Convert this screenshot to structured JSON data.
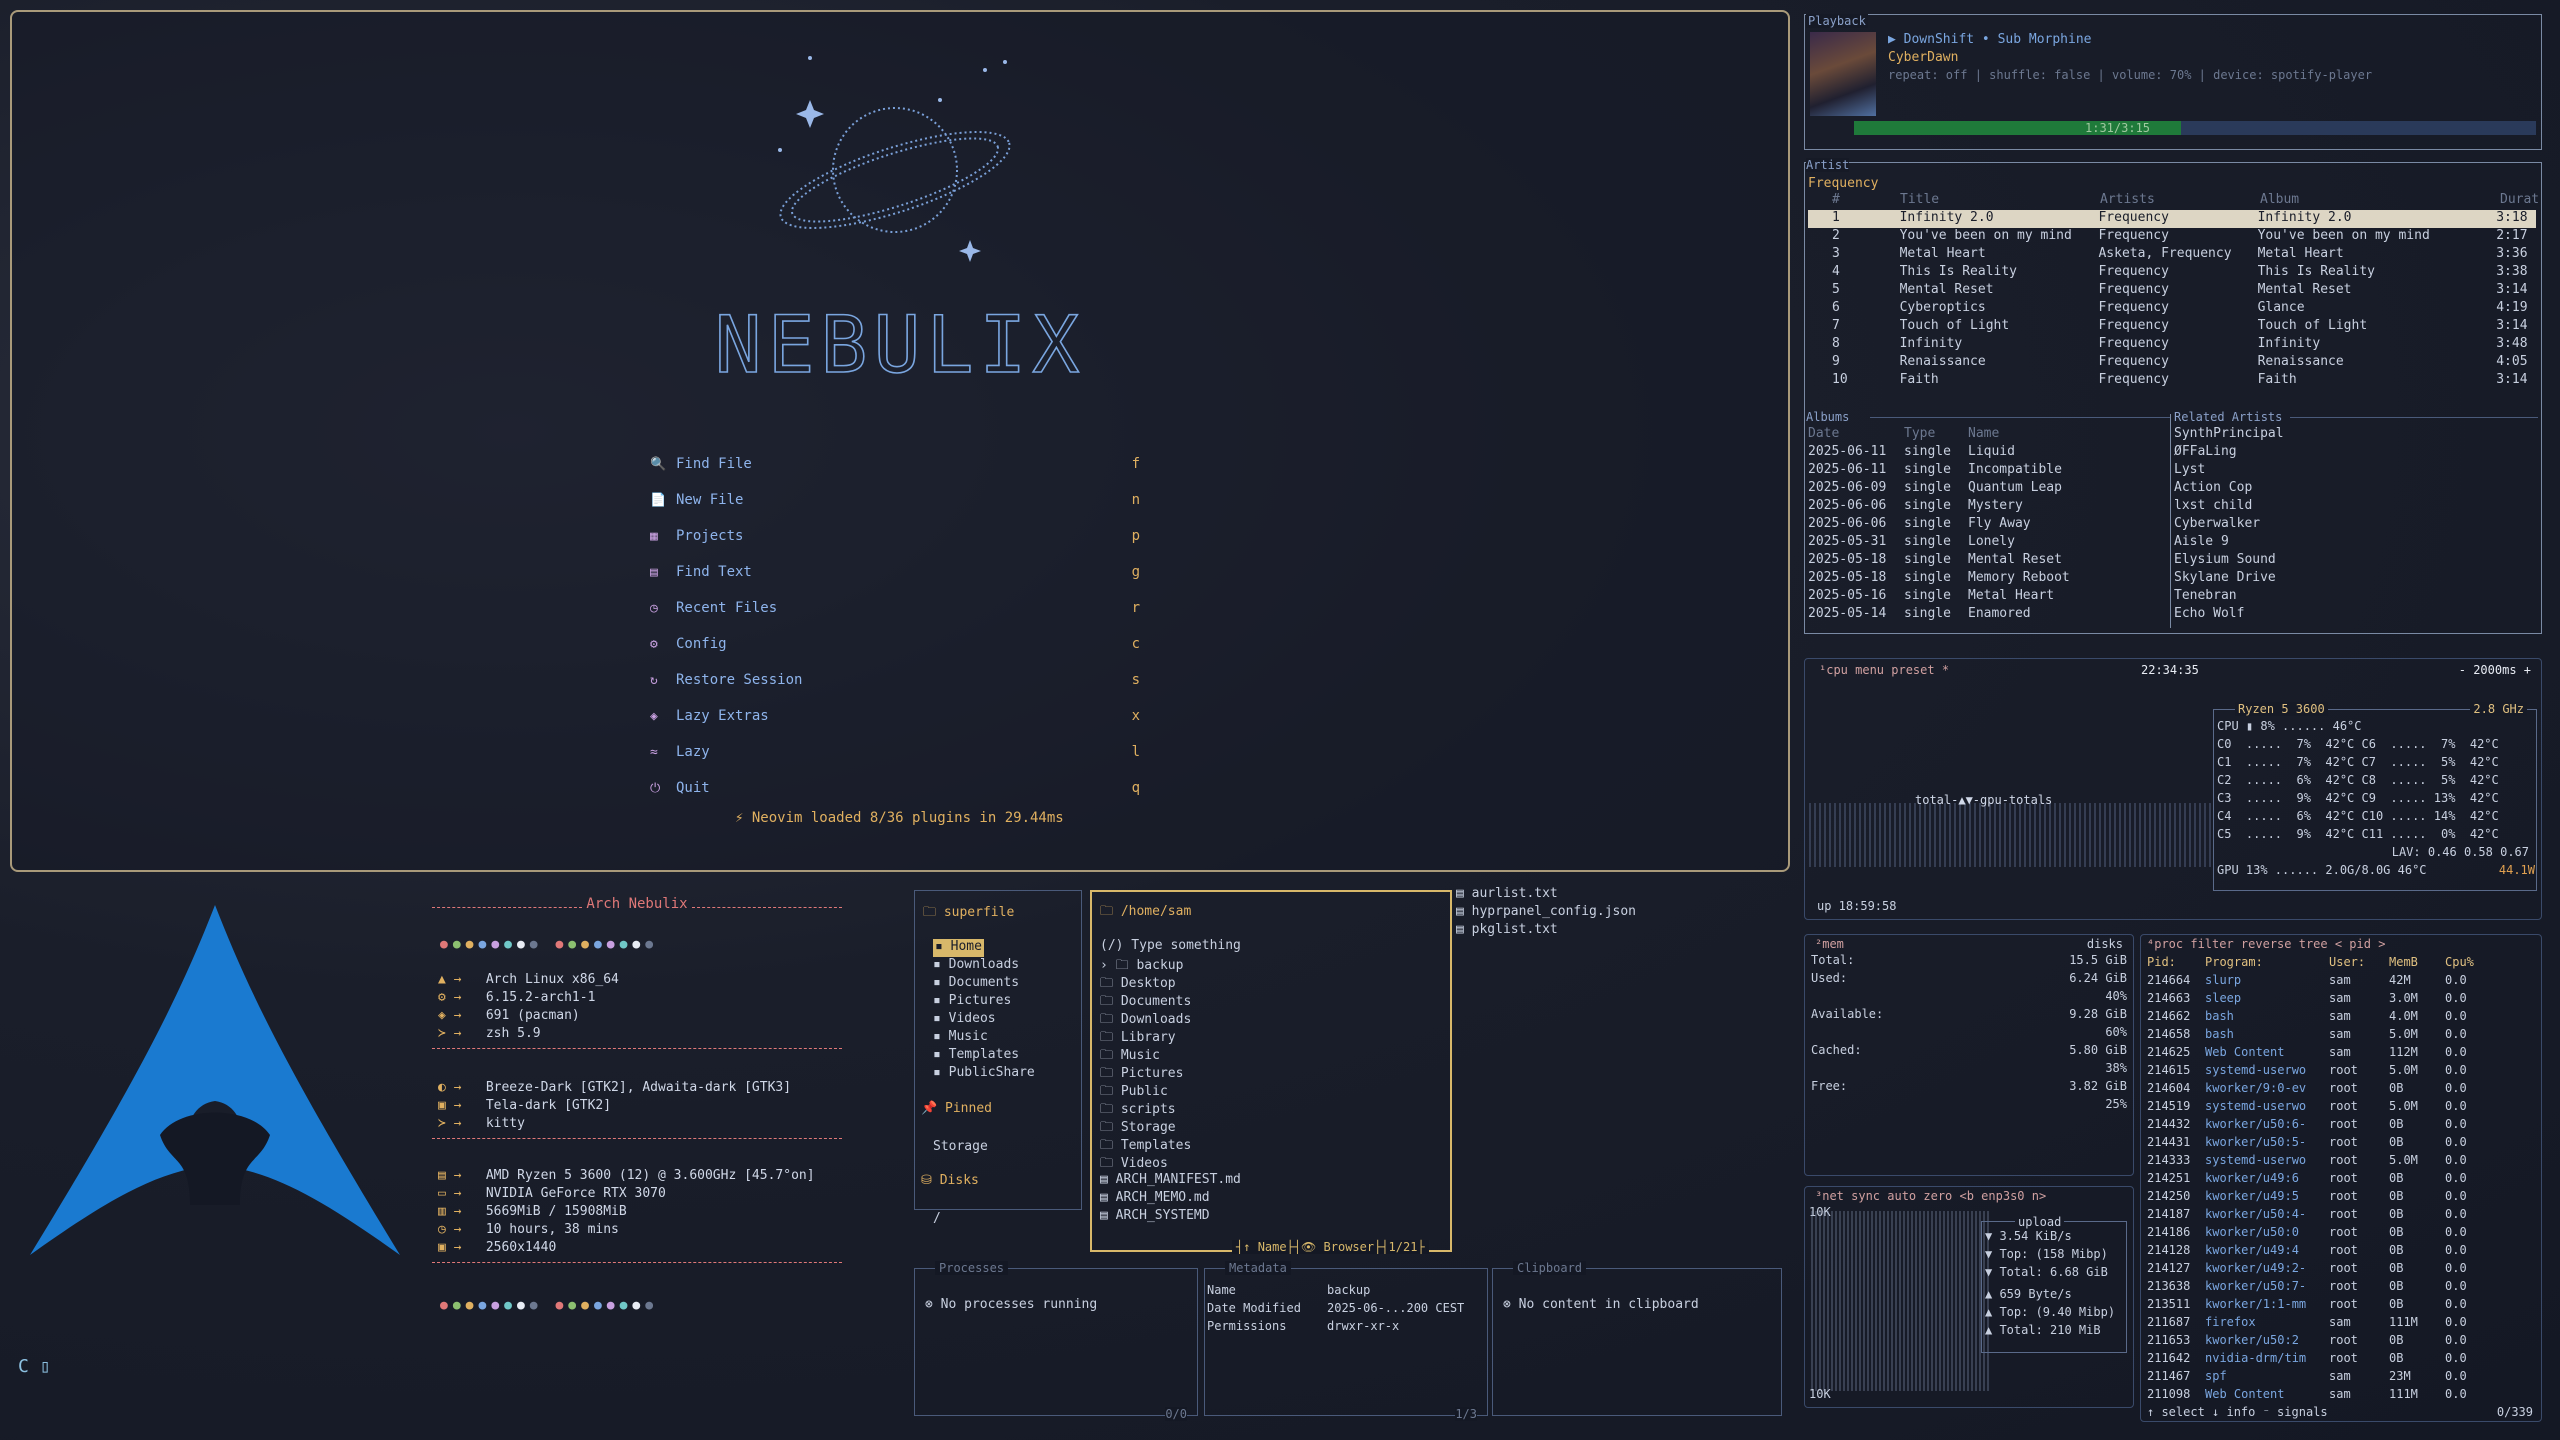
{
  "nvim": {
    "logo_text": "NEBULIX",
    "menu": [
      {
        "icon": "🔍",
        "label": "Find File",
        "key": "f"
      },
      {
        "icon": "📄",
        "label": "New File",
        "key": "n"
      },
      {
        "icon": "▦",
        "label": "Projects",
        "key": "p"
      },
      {
        "icon": "▤",
        "label": "Find Text",
        "key": "g"
      },
      {
        "icon": "◷",
        "label": "Recent Files",
        "key": "r"
      },
      {
        "icon": "⚙",
        "label": "Config",
        "key": "c"
      },
      {
        "icon": "↻",
        "label": "Restore Session",
        "key": "s"
      },
      {
        "icon": "◈",
        "label": "Lazy Extras",
        "key": "x"
      },
      {
        "icon": "≈",
        "label": "Lazy",
        "key": "l"
      },
      {
        "icon": "⏻",
        "label": "Quit",
        "key": "q"
      }
    ],
    "loaded": "⚡ Neovim loaded 8/36 plugins in 29.44ms"
  },
  "fastfetch": {
    "title": "Arch Nebulix",
    "rows1": [
      "Arch Linux x86_64",
      "6.15.2-arch1-1",
      "691 (pacman)",
      "zsh 5.9"
    ],
    "rows2": [
      "Breeze-Dark [GTK2], Adwaita-dark [GTK3]",
      "Tela-dark [GTK2]",
      "kitty"
    ],
    "rows3": [
      "AMD Ryzen 5 3600 (12) @ 3.600GHz [45.7°on]",
      "NVIDIA GeForce RTX 3070",
      "5669MiB / 15908MiB",
      "10 hours, 38 mins",
      "2560x1440"
    ],
    "prompt": "C"
  },
  "playback": {
    "label": "Playback",
    "now": "▶ DownShift • Sub Morphine",
    "album": "CyberDawn",
    "status": "repeat: off | shuffle: false | volume: 70% | device: spotify-player",
    "progress_fraction": 0.48,
    "progress_text": "1:31/3:15"
  },
  "artist": {
    "label": "Artist",
    "name": "Frequency",
    "headers": [
      "#",
      "Title",
      "Artists",
      "Album",
      "Durati"
    ],
    "tracks": [
      [
        "1",
        "Infinity 2.0",
        "Frequency",
        "Infinity 2.0",
        "3:18"
      ],
      [
        "2",
        "You've been on my mind",
        "Frequency",
        "You've been on my mind",
        "2:17"
      ],
      [
        "3",
        "Metal Heart",
        "Asketa, Frequency",
        "Metal Heart",
        "3:36"
      ],
      [
        "4",
        "This Is Reality",
        "Frequency",
        "This Is Reality",
        "3:38"
      ],
      [
        "5",
        "Mental Reset",
        "Frequency",
        "Mental Reset",
        "3:14"
      ],
      [
        "6",
        "Cyberoptics",
        "Frequency",
        "Glance",
        "4:19"
      ],
      [
        "7",
        "Touch of Light",
        "Frequency",
        "Touch of Light",
        "3:14"
      ],
      [
        "8",
        "Infinity",
        "Frequency",
        "Infinity",
        "3:48"
      ],
      [
        "9",
        "Renaissance",
        "Frequency",
        "Renaissance",
        "4:05"
      ],
      [
        "10",
        "Faith",
        "Frequency",
        "Faith",
        "3:14"
      ]
    ],
    "albums_label": "Albums",
    "albums_headers": [
      "Date",
      "Type",
      "Name"
    ],
    "albums": [
      [
        "2025-06-11",
        "single",
        "Liquid"
      ],
      [
        "2025-06-11",
        "single",
        "Incompatible"
      ],
      [
        "2025-06-09",
        "single",
        "Quantum Leap"
      ],
      [
        "2025-06-06",
        "single",
        "Mystery"
      ],
      [
        "2025-06-06",
        "single",
        "Fly Away"
      ],
      [
        "2025-05-31",
        "single",
        "Lonely"
      ],
      [
        "2025-05-18",
        "single",
        "Mental Reset"
      ],
      [
        "2025-05-18",
        "single",
        "Memory Reboot"
      ],
      [
        "2025-05-16",
        "single",
        "Metal Heart"
      ],
      [
        "2025-05-14",
        "single",
        "Enamored"
      ]
    ],
    "related_label": "Related Artists",
    "related": [
      "SynthPrincipal",
      "ØFFaLing",
      "Lyst",
      "Action Cop",
      "lxst child",
      "Cyberwalker",
      "Aisle 9",
      "Elysium Sound",
      "Skylane Drive",
      "Tenebran",
      "Echo Wolf"
    ]
  },
  "btop": {
    "cpu_header": "¹cpu  menu  preset *",
    "time": "22:34:35",
    "interval": "- 2000ms +",
    "cpu_model": "Ryzen 5 3600",
    "freq": "2.8 GHz",
    "cpu_total": "CPU ▮          8%  ......  46°C",
    "cores": [
      "C0  .....  7%  42°C C6  .....  7%  42°C",
      "C1  .....  7%  42°C C7  .....  5%  42°C",
      "C2  .....  6%  42°C C8  .....  5%  42°C",
      "C3  .....  9%  42°C C9  ..... 13%  42°C",
      "C4  .....  6%  42°C C10 ..... 14%  42°C",
      "C5  .....  9%  42°C C11 .....  0%  42°C"
    ],
    "lav": "LAV: 0.46 0.58 0.67",
    "gpu": "GPU  13%  ......  2.0G/8.0G   46°C",
    "gpu_w": "44.1W",
    "totals": "total-▲▼-gpu-totals",
    "uptime": "up 18:59:58",
    "mem_header": "²mem",
    "disks": "disks",
    "mem": [
      [
        "Total:",
        "15.5 GiB"
      ],
      [
        "Used:",
        "6.24 GiB"
      ],
      [
        "",
        "40%"
      ],
      [
        "Available:",
        "9.28 GiB"
      ],
      [
        "",
        "60%"
      ],
      [
        "Cached:",
        "5.80 GiB"
      ],
      [
        "",
        "38%"
      ],
      [
        "Free:",
        "3.82 GiB"
      ],
      [
        "",
        "25%"
      ]
    ],
    "net_header": "³net  sync  auto  zero  <b enp3s0 n>",
    "net_scale_top": "10K",
    "net_scale_bottom": "10K",
    "net_down": [
      "▼ 3.54 KiB/s",
      "▼ Top: (158 Mibp)",
      "▼ Total: 6.68 GiB"
    ],
    "net_up": [
      "▲ 659 Byte/s",
      "▲ Top: (9.40 Mibp)",
      "▲ Total:  210 MiB"
    ],
    "upload_label": "upload",
    "proc_header": "⁴proc  filter   reverse  tree  < pid >",
    "proc_cols": [
      "Pid:",
      "Program:",
      "User:",
      "MemB",
      "Cpu%"
    ],
    "procs": [
      [
        "214664",
        "slurp",
        "sam",
        "42M",
        "0.0"
      ],
      [
        "214663",
        "sleep",
        "sam",
        "3.0M",
        "0.0"
      ],
      [
        "214662",
        "bash",
        "sam",
        "4.0M",
        "0.0"
      ],
      [
        "214658",
        "bash",
        "sam",
        "5.0M",
        "0.0"
      ],
      [
        "214625",
        "Web Content",
        "sam",
        "112M",
        "0.0"
      ],
      [
        "214615",
        "systemd-userwo",
        "root",
        "5.0M",
        "0.0"
      ],
      [
        "214604",
        "kworker/9:0-ev",
        "root",
        "0B",
        "0.0"
      ],
      [
        "214519",
        "systemd-userwo",
        "root",
        "5.0M",
        "0.0"
      ],
      [
        "214432",
        "kworker/u50:6-",
        "root",
        "0B",
        "0.0"
      ],
      [
        "214431",
        "kworker/u50:5-",
        "root",
        "0B",
        "0.0"
      ],
      [
        "214333",
        "systemd-userwo",
        "root",
        "5.0M",
        "0.0"
      ],
      [
        "214251",
        "kworker/u49:6",
        "root",
        "0B",
        "0.0"
      ],
      [
        "214250",
        "kworker/u49:5",
        "root",
        "0B",
        "0.0"
      ],
      [
        "214187",
        "kworker/u50:4-",
        "root",
        "0B",
        "0.0"
      ],
      [
        "214186",
        "kworker/u50:0",
        "root",
        "0B",
        "0.0"
      ],
      [
        "214128",
        "kworker/u49:4",
        "root",
        "0B",
        "0.0"
      ],
      [
        "214127",
        "kworker/u49:2-",
        "root",
        "0B",
        "0.0"
      ],
      [
        "213638",
        "kworker/u50:7-",
        "root",
        "0B",
        "0.0"
      ],
      [
        "213511",
        "kworker/1:1-mm",
        "root",
        "0B",
        "0.0"
      ],
      [
        "211687",
        "firefox",
        "sam",
        "111M",
        "0.0"
      ],
      [
        "211653",
        "kworker/u50:2",
        "root",
        "0B",
        "0.0"
      ],
      [
        "211642",
        "nvidia-drm/tim",
        "root",
        "0B",
        "0.0"
      ],
      [
        "211467",
        "spf",
        "sam",
        "23M",
        "0.0"
      ],
      [
        "211098",
        "Web Content",
        "sam",
        "111M",
        "0.0"
      ]
    ],
    "proc_footer": "↑ select ↓  info  ⁻ signals",
    "proc_count": "0/339"
  },
  "superfile": {
    "side_title": "superfile",
    "side_items": [
      "Home",
      "Downloads",
      "Documents",
      "Pictures",
      "Videos",
      "Music",
      "Templates",
      "PublicShare"
    ],
    "pinned_label": "Pinned",
    "pinned": [
      "Storage"
    ],
    "disks_label": "Disks",
    "disks": [
      "/"
    ],
    "path": "/home/sam",
    "search": "(/) Type something",
    "files": [
      "backup",
      "Desktop",
      "Documents",
      "Downloads",
      "Library",
      "Music",
      "Pictures",
      "Public",
      "scripts",
      "Storage",
      "Templates",
      "Videos",
      "ARCH_MANIFEST.md",
      "ARCH_MEMO.md",
      "ARCH_SYSTEMD"
    ],
    "footer_sort": "Name",
    "footer_mode": "Browser",
    "footer_count": "1/21",
    "extra_files": [
      "aurlist.txt",
      "hyprpanel_config.json",
      "pkglist.txt"
    ],
    "processes_label": "Processes",
    "processes_empty": "No processes running",
    "processes_count": "0/0",
    "metadata_label": "Metadata",
    "meta": [
      [
        "Name",
        "backup"
      ],
      [
        "Date Modified",
        "2025-06-...200 CEST"
      ],
      [
        "Permissions",
        "drwxr-xr-x"
      ]
    ],
    "meta_count": "1/3",
    "clipboard_label": "Clipboard",
    "clipboard_empty": "No content in clipboard"
  },
  "colors": {
    "accent": "#7aa6e0",
    "border_active": "#d8b86a",
    "arch_blue": "#1a7ad0"
  }
}
